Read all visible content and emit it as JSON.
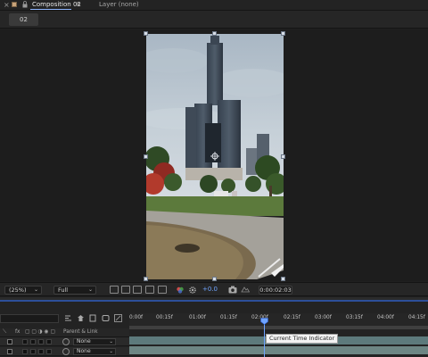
{
  "window": {
    "close_glyph": "×",
    "comp_tab_label": "Composition 02",
    "menu_glyph": "≡",
    "layer_tab_label": "Layer (none)"
  },
  "breadcrumb": {
    "label": "02"
  },
  "viewer": {
    "zoom_value": "(25%)",
    "resolution_value": "Full",
    "exposure_value": "+0.0",
    "current_time": "0:00:02:03",
    "chevron": "⌄"
  },
  "timeline": {
    "column_headers": {
      "fx": "fx",
      "parent_link": "Parent & Link"
    },
    "layers": [
      {
        "parent": "None"
      },
      {
        "parent": "None"
      }
    ],
    "ruler_labels": [
      "0:00f",
      "00:15f",
      "01:00f",
      "01:15f",
      "02:00f",
      "02:15f",
      "03:00f",
      "03:15f",
      "04:00f",
      "04:15f"
    ],
    "ruler_start_label": "0:00f",
    "tooltip": "Current Time Indicator",
    "colors": {
      "accent": "#2d4f9a",
      "playhead": "#6fa4ff",
      "track": "#5d7a7c"
    }
  },
  "icons": [
    "close-icon",
    "composition-swatch-icon",
    "lock-icon",
    "menu-icon",
    "search-icon",
    "anchor-point-icon",
    "camera-icon",
    "playhead-icon"
  ]
}
